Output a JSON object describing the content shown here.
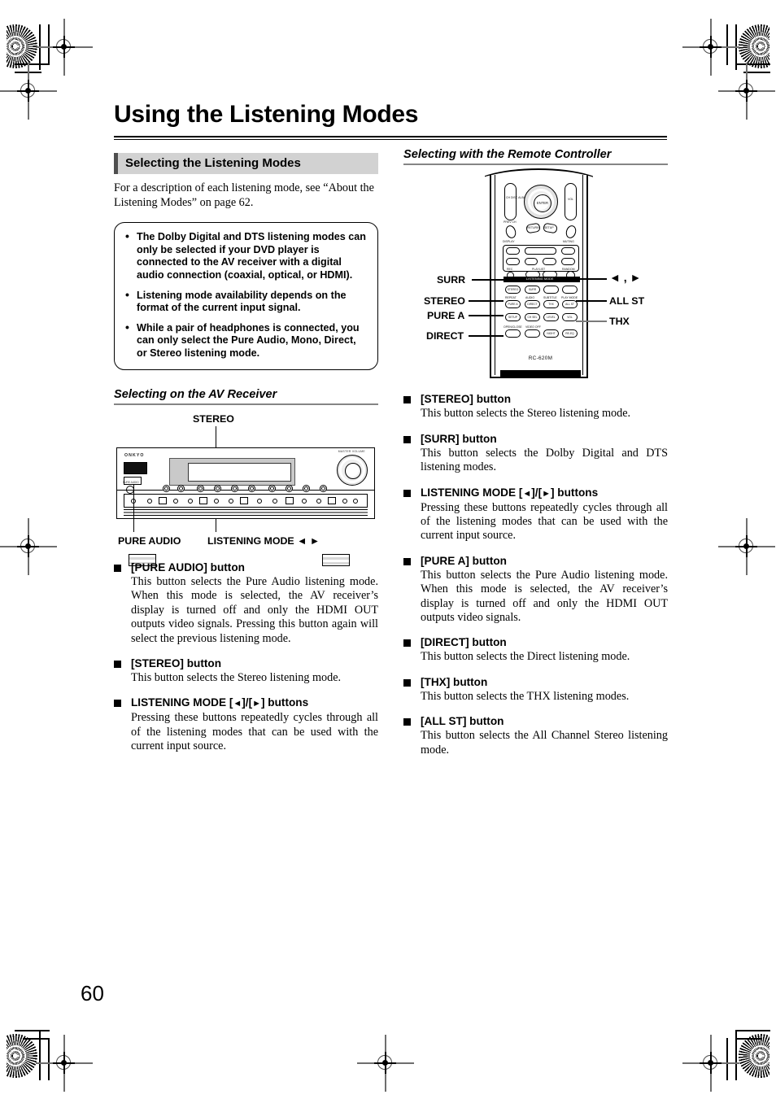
{
  "page": {
    "title": "Using the Listening Modes",
    "number": "60"
  },
  "left_column": {
    "section_heading": "Selecting the Listening Modes",
    "intro": "For a description of each listening mode, see “About the Listening Modes” on page 62.",
    "notes": [
      "The Dolby Digital and DTS listening modes can only be selected if your DVD player is connected to the AV receiver with a digital audio connection (coaxial, optical, or HDMI).",
      "Listening mode availability depends on the format of the current input signal.",
      "While a pair of headphones is connected, you can only select the Pure Audio, Mono, Direct, or Stereo listening mode."
    ],
    "subheading": "Selecting on the AV Receiver",
    "receiver_callouts": {
      "stereo": "STEREO",
      "pure_audio": "PURE AUDIO",
      "listening_mode": "LISTENING MODE",
      "listening_mode_arrows": "◄ ►"
    },
    "receiver": {
      "brand": "ONKYO",
      "master_volume_caption": "MASTER VOLUME",
      "pure_audio_caption": "PURE AUDIO"
    },
    "entries": [
      {
        "title": "[PURE AUDIO] button",
        "text": "This button selects the Pure Audio listening mode. When this mode is selected, the AV receiver’s display is turned off and only the HDMI OUT outputs video signals. Pressing this button again will select the previous listening mode."
      },
      {
        "title": "[STEREO] button",
        "text": "This button selects the Stereo listening mode."
      },
      {
        "title_pre": "LISTENING MODE [",
        "title_mid": "]/[",
        "title_post": "] buttons",
        "arrow_left": "◄",
        "arrow_right": "►",
        "text": "Pressing these buttons repeatedly cycles through all of the listening modes that can be used with the current input source."
      }
    ]
  },
  "right_column": {
    "subheading": "Selecting with the Remote Controller",
    "remote": {
      "model": "RC-620M",
      "listening_mode_bar": "LISTENING MODE",
      "dpad_center": "ENTER",
      "captions": {
        "ch_disc_album": "CH DISC ALBUM",
        "vol": "VOL",
        "prev_ch": "PREV CH",
        "return": "RETURN",
        "setup": "SETUP",
        "display": "DISPLAY",
        "muting": "MUTING",
        "rec": "REC",
        "playlist": "PLAYLIST",
        "random": "RANDOM",
        "repeat": "REPEAT",
        "audio": "AUDIO",
        "subtitle": "SUBTITLE",
        "play_mode": "PLAY MODE",
        "open_close": "OPEN/CLOSE",
        "video_off": "VIDEO OFF"
      },
      "buttons": {
        "stereo": "STEREO",
        "surr": "SURR",
        "pure_a": "PURE A",
        "direct": "DIRECT",
        "thx": "THX",
        "all_st": "ALL ST",
        "setup_b": "SETUP",
        "ch_sel": "CH SEL",
        "level_minus": "LEVEL",
        "level_plus": "VOL",
        "night": "NIGHT",
        "re_eq": "RE-EQ"
      },
      "callouts_left": [
        "SURR",
        "STEREO",
        "PURE A",
        "DIRECT"
      ],
      "callouts_right": [
        "◄ , ►",
        "ALL ST",
        "THX"
      ]
    },
    "entries": [
      {
        "title": "[STEREO] button",
        "text": "This button selects the Stereo listening mode."
      },
      {
        "title": "[SURR] button",
        "text": "This button selects the Dolby Digital and DTS listening modes."
      },
      {
        "title_pre": "LISTENING MODE [",
        "title_mid": "]/[",
        "title_post": "] buttons",
        "arrow_left": "◄",
        "arrow_right": "►",
        "text": "Pressing these buttons repeatedly cycles through all of the listening modes that can be used with the current input source."
      },
      {
        "title": "[PURE A] button",
        "text": "This button selects the Pure Audio listening mode. When this mode is selected, the AV receiver’s display is turned off and only the HDMI OUT outputs video signals."
      },
      {
        "title": "[DIRECT] button",
        "text": "This button selects the Direct listening mode."
      },
      {
        "title": "[THX] button",
        "text": "This button selects the THX listening modes."
      },
      {
        "title": "[ALL ST] button",
        "text": "This button selects the All Channel Stereo listening mode."
      }
    ]
  },
  "colors": {
    "heading_bg": "#d2d2d2",
    "heading_accent": "#4f4f4f",
    "rule": "#858585"
  }
}
